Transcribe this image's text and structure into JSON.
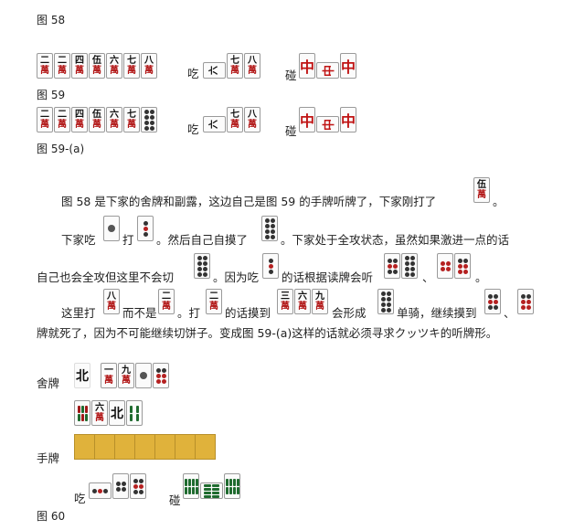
{
  "captions": {
    "fig58": "图 58",
    "fig59": "图 59",
    "fig59a": "图 59-(a)",
    "fig60": "图 60"
  },
  "labels": {
    "chi": "吃",
    "peng": "碰",
    "discard": "舍牌",
    "hand": "手牌"
  },
  "paragraph": [
    "图 58 是下家的舍牌和副露，这边自己是图 59 的手牌听牌了，下家刚打了",
    "。",
    "下家吃",
    "打",
    "。然后自己自摸了",
    "。下家处于全攻状态，虽然如果激进一点的话",
    "自己也会全攻但这里不会切",
    "。因为吃",
    "的话根据读牌会听",
    "、",
    "。",
    "这里打",
    "而不是",
    "。打",
    "的话摸到",
    "会形成",
    "单骑，继续摸到",
    "、",
    "牌就死了，因为不可能继续切饼子。变成图 59-(a)这样的话就必须寻求クッツキ的听牌形。"
  ],
  "tiles": {
    "man2": {
      "n": "二",
      "m": "萬"
    },
    "man3": {
      "n": "三",
      "m": "萬"
    },
    "man4": {
      "n": "四",
      "m": "萬"
    },
    "man5": {
      "n": "伍",
      "m": "萬"
    },
    "man6": {
      "n": "六",
      "m": "萬"
    },
    "man7": {
      "n": "七",
      "m": "萬"
    },
    "man8": {
      "n": "八",
      "m": "萬"
    },
    "man9": {
      "n": "九",
      "m": "萬"
    },
    "man1": {
      "n": "一",
      "m": "萬"
    },
    "chun": "中",
    "pei": "北"
  },
  "colors": {
    "accent_red": "#b21818",
    "hand_gold": "#e0b23b"
  }
}
